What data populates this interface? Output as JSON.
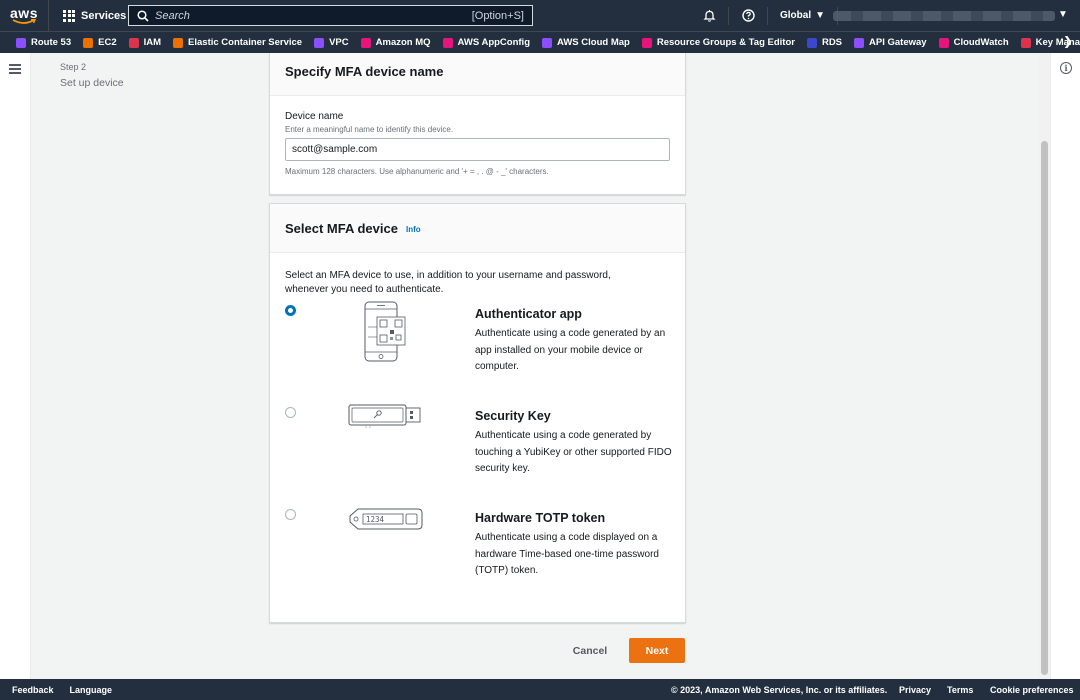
{
  "topnav": {
    "logo": "aws",
    "services_label": "Services",
    "search_placeholder": "Search",
    "search_shortcut": "[Option+S]",
    "region": "Global"
  },
  "favorites": [
    {
      "label": "Route 53",
      "color": "#8c4fff"
    },
    {
      "label": "EC2",
      "color": "#ed7100"
    },
    {
      "label": "IAM",
      "color": "#dd344c"
    },
    {
      "label": "Elastic Container Service",
      "color": "#ed7100"
    },
    {
      "label": "VPC",
      "color": "#8c4fff"
    },
    {
      "label": "Amazon MQ",
      "color": "#e7157b"
    },
    {
      "label": "AWS AppConfig",
      "color": "#e7157b"
    },
    {
      "label": "AWS Cloud Map",
      "color": "#8c4fff"
    },
    {
      "label": "Resource Groups & Tag Editor",
      "color": "#e7157b"
    },
    {
      "label": "RDS",
      "color": "#3b48cc"
    },
    {
      "label": "API Gateway",
      "color": "#8c4fff"
    },
    {
      "label": "CloudWatch",
      "color": "#e7157b"
    },
    {
      "label": "Key Managemer",
      "color": "#dd344c"
    }
  ],
  "steps": {
    "number": "Step 2",
    "title": "Set up device"
  },
  "device_card": {
    "title": "Specify MFA device name",
    "field_label": "Device name",
    "field_desc": "Enter a meaningful name to identify this device.",
    "field_value": "scott@sample.com",
    "constraint": "Maximum 128 characters. Use alphanumeric and '+ = , . @ - _' characters."
  },
  "mfa_card": {
    "title": "Select MFA device",
    "info_link": "Info",
    "intro": "Select an MFA device to use, in addition to your username and password, whenever you need to authenticate.",
    "options": [
      {
        "title": "Authenticator app",
        "desc": "Authenticate using a code generated by an app installed on your mobile device or computer.",
        "selected": true,
        "icon": "phone-qr-icon"
      },
      {
        "title": "Security Key",
        "desc": "Authenticate using a code generated by touching a YubiKey or other supported FIDO security key.",
        "selected": false,
        "icon": "usb-key-icon"
      },
      {
        "title": "Hardware TOTP token",
        "desc": "Authenticate using a code displayed on a hardware Time-based one-time password (TOTP) token.",
        "selected": false,
        "icon": "token-icon",
        "token_digits": "1234"
      }
    ]
  },
  "actions": {
    "cancel": "Cancel",
    "next": "Next",
    "next_color": "#ec7211"
  },
  "footer": {
    "feedback": "Feedback",
    "language": "Language",
    "copyright": "© 2023, Amazon Web Services, Inc. or its affiliates.",
    "privacy": "Privacy",
    "terms": "Terms",
    "cookies": "Cookie preferences"
  }
}
